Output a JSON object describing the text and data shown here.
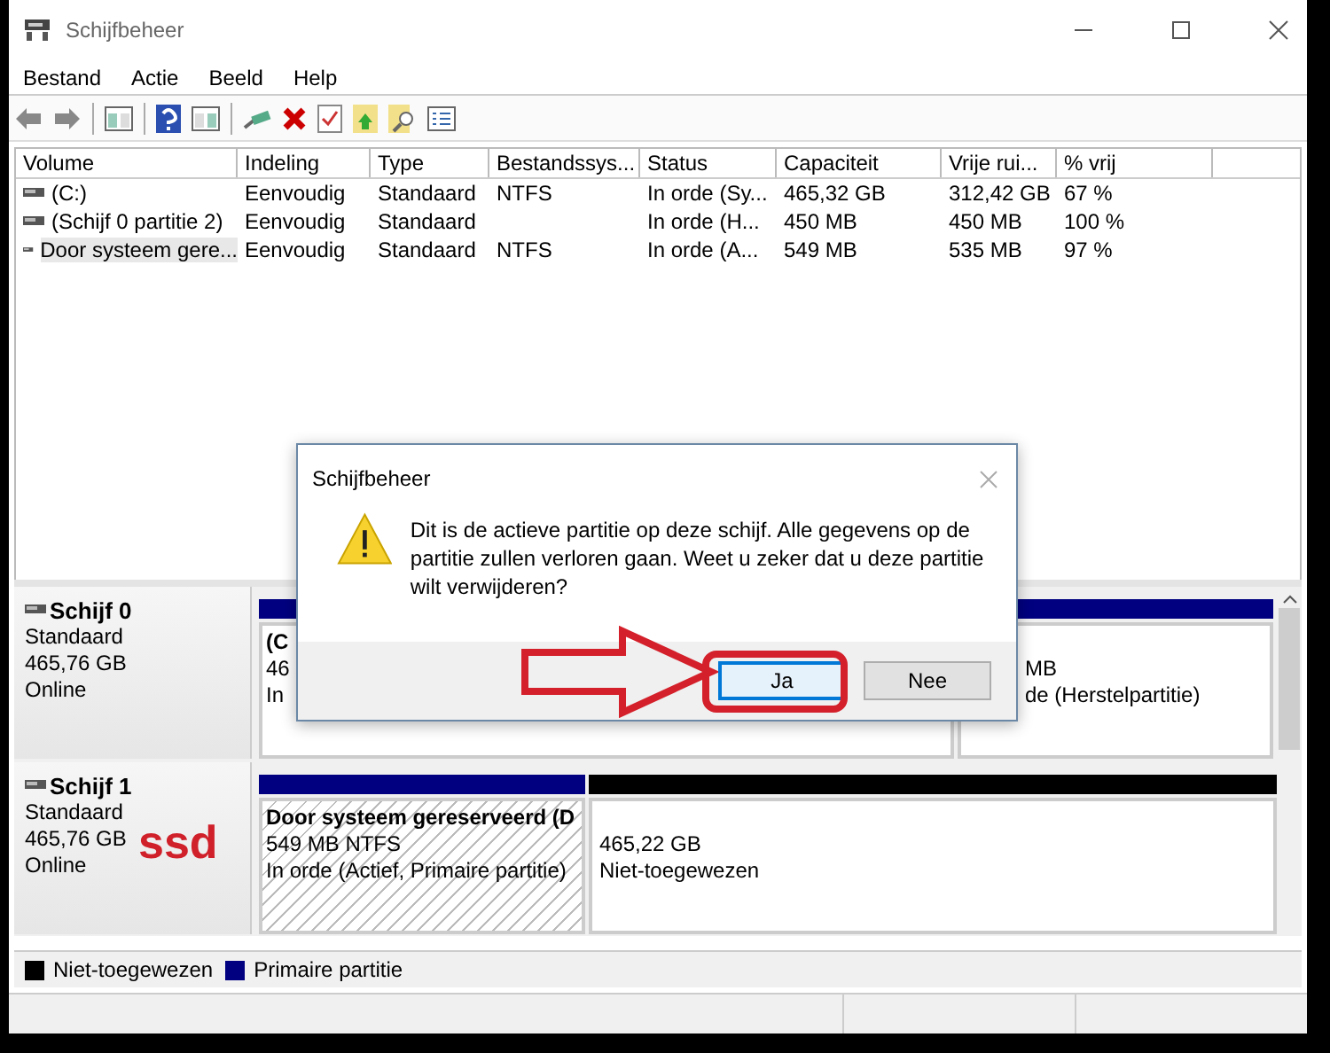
{
  "window": {
    "title": "Schijfbeheer"
  },
  "menu": [
    "Bestand",
    "Actie",
    "Beeld",
    "Help"
  ],
  "table": {
    "columns": [
      "Volume",
      "Indeling",
      "Type",
      "Bestandssys...",
      "Status",
      "Capaciteit",
      "Vrije rui...",
      "% vrij"
    ],
    "rows": [
      {
        "cells": [
          "(C:)",
          "Eenvoudig",
          "Standaard",
          "NTFS",
          "In orde (Sy...",
          "465,32 GB",
          "312,42 GB",
          "67 %"
        ],
        "selected": false
      },
      {
        "cells": [
          "(Schijf 0 partitie 2)",
          "Eenvoudig",
          "Standaard",
          "",
          "In orde (H...",
          "450 MB",
          "450 MB",
          "100 %"
        ],
        "selected": false
      },
      {
        "cells": [
          "Door systeem gere...",
          "Eenvoudig",
          "Standaard",
          "NTFS",
          "In orde (A...",
          "549 MB",
          "535 MB",
          "97 %"
        ],
        "selected": true
      }
    ]
  },
  "disks": [
    {
      "name": "Schijf 0",
      "type": "Standaard",
      "size": "465,76 GB",
      "status": "Online",
      "partitions": [
        {
          "kind": "primary",
          "selected": false,
          "label": "(C",
          "size": "46",
          "status": "In"
        },
        {
          "kind": "primary",
          "selected": false,
          "size": "MB",
          "status": "de (Herstelpartitie)"
        }
      ]
    },
    {
      "name": "Schijf 1",
      "type": "Standaard",
      "size": "465,76 GB",
      "status": "Online",
      "annotation": "ssd",
      "partitions": [
        {
          "kind": "primary",
          "selected": true,
          "label": "Door systeem gereserveerd  (D",
          "size": "549 MB NTFS",
          "status": "In orde (Actief, Primaire partitie)"
        },
        {
          "kind": "unallocated",
          "selected": false,
          "size": "465,22 GB",
          "status": "Niet-toegewezen"
        }
      ]
    }
  ],
  "legend": [
    {
      "label": "Niet-toegewezen",
      "color": "#000000"
    },
    {
      "label": "Primaire partitie",
      "color": "#000080"
    }
  ],
  "dialog": {
    "title": "Schijfbeheer",
    "message": "Dit is de actieve partitie op deze schijf. Alle gegevens op de partitie zullen verloren gaan. Weet u zeker dat u deze partitie wilt verwijderen?",
    "buttons": [
      {
        "label": "Ja",
        "default": true
      },
      {
        "label": "Nee",
        "default": false
      }
    ]
  }
}
